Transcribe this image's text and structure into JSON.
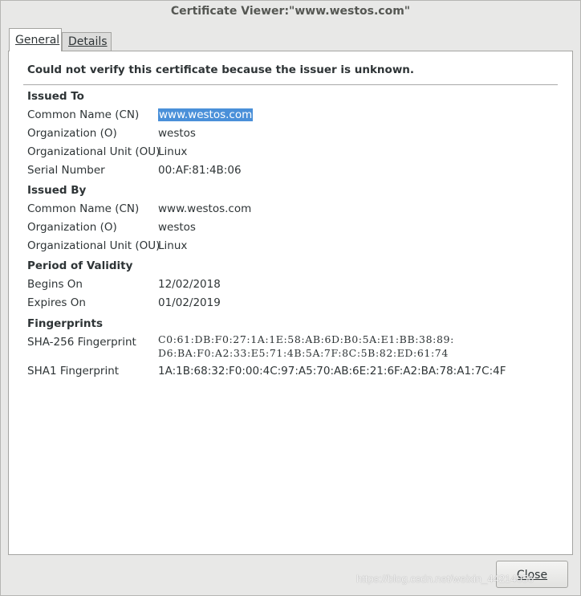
{
  "window": {
    "title": "Certificate Viewer:\"www.westos.com\""
  },
  "tabs": [
    {
      "label": "General",
      "active": true
    },
    {
      "label": "Details",
      "active": false
    }
  ],
  "warning": "Could not verify this certificate because the issuer is unknown.",
  "issued_to": {
    "heading": "Issued To",
    "rows": [
      {
        "label": "Common Name (CN)",
        "value": "www.westos.com"
      },
      {
        "label": "Organization (O)",
        "value": "westos"
      },
      {
        "label": "Organizational Unit (OU)",
        "value": "Linux"
      },
      {
        "label": "Serial Number",
        "value": "00:AF:81:4B:06"
      }
    ]
  },
  "issued_by": {
    "heading": "Issued By",
    "rows": [
      {
        "label": "Common Name (CN)",
        "value": "www.westos.com"
      },
      {
        "label": "Organization (O)",
        "value": "westos"
      },
      {
        "label": "Organizational Unit (OU)",
        "value": "Linux"
      }
    ]
  },
  "validity": {
    "heading": "Period of Validity",
    "rows": [
      {
        "label": "Begins On",
        "value": "12/02/2018"
      },
      {
        "label": "Expires On",
        "value": "01/02/2019"
      }
    ]
  },
  "fingerprints": {
    "heading": "Fingerprints",
    "sha256_label": "SHA-256 Fingerprint",
    "sha256_line1": "C0:61:DB:F0:27:1A:1E:58:AB:6D:B0:5A:E1:BB:38:89:",
    "sha256_line2": "D6:BA:F0:A2:33:E5:71:4B:5A:7F:8C:5B:82:ED:61:74",
    "sha1_label": "SHA1 Fingerprint",
    "sha1_value": "1A:1B:68:32:F0:00:4C:97:A5:70:AB:6E:21:6F:A2:BA:78:A1:7C:4F"
  },
  "buttons": {
    "close": "Close"
  },
  "watermark": "https://blog.csdn.net/weixin_44214056",
  "colors": {
    "selection": "#4a90d9",
    "background": "#e8e8e7",
    "panel": "#ffffff"
  }
}
